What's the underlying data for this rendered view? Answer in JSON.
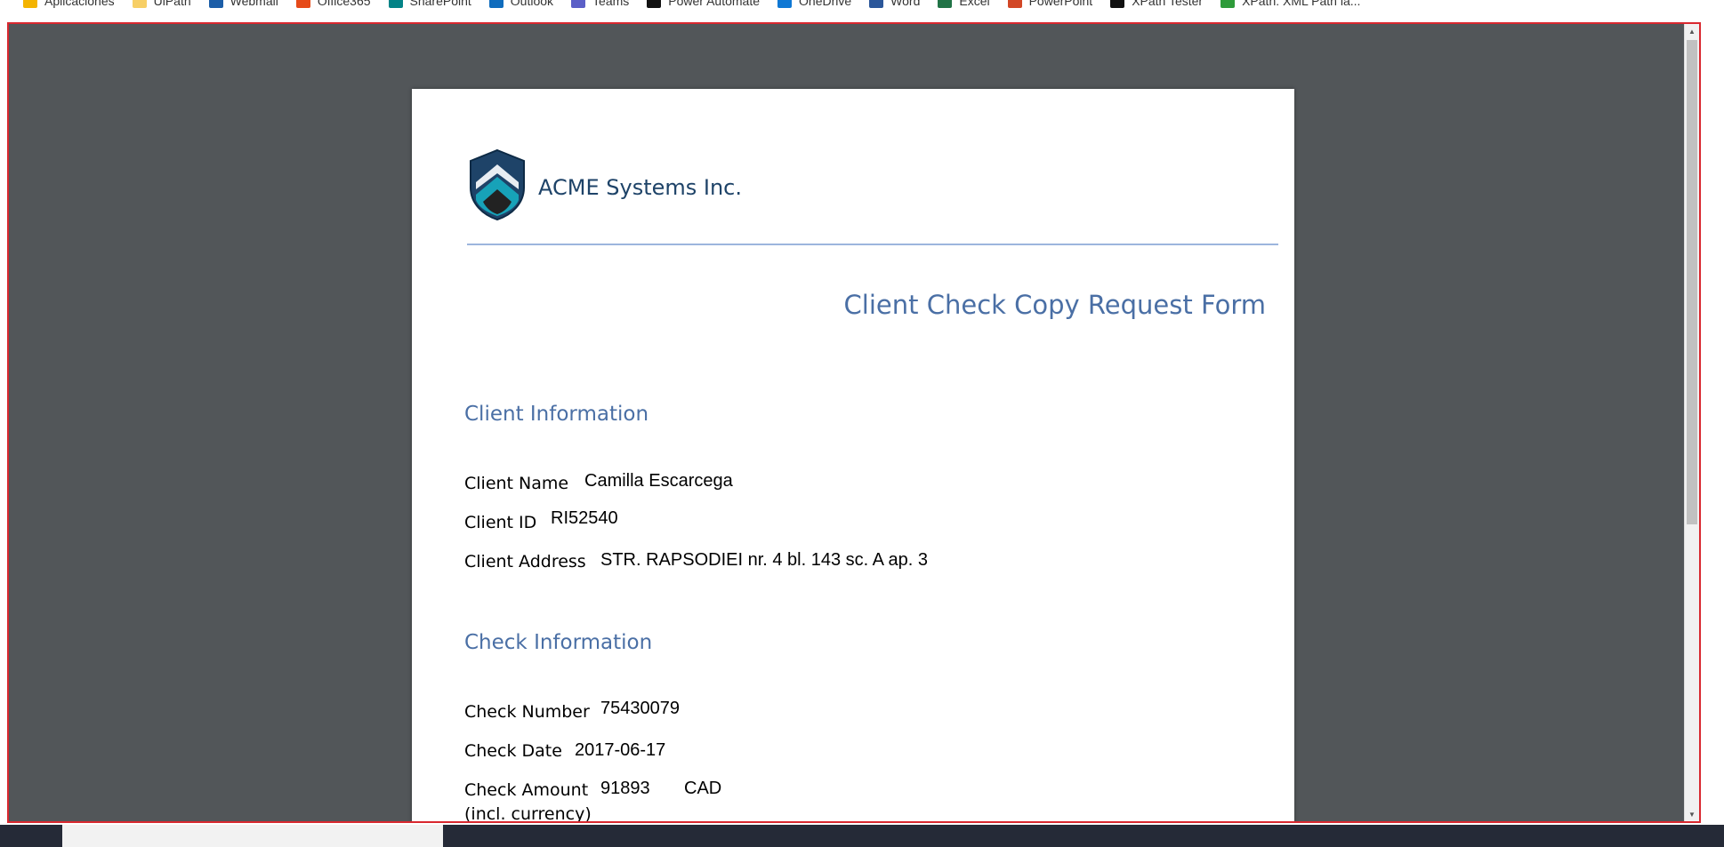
{
  "bookmarks": [
    {
      "label": "Aplicaciones",
      "icon": "apps-grid-icon",
      "color": "#f4b400"
    },
    {
      "label": "UiPath",
      "icon": "folder-icon",
      "color": "#f7cf66"
    },
    {
      "label": "Webmail",
      "icon": "mail-icon",
      "color": "#1c5ea8"
    },
    {
      "label": "Office365",
      "icon": "office-icon",
      "color": "#e64a19"
    },
    {
      "label": "SharePoint",
      "icon": "sharepoint-icon",
      "color": "#038387"
    },
    {
      "label": "Outlook",
      "icon": "outlook-icon",
      "color": "#0f6cbd"
    },
    {
      "label": "Teams",
      "icon": "teams-icon",
      "color": "#5b5fc7"
    },
    {
      "label": "Power Automate",
      "icon": "power-automate-icon",
      "color": "#111111"
    },
    {
      "label": "OneDrive",
      "icon": "onedrive-icon",
      "color": "#0f78d4"
    },
    {
      "label": "Word",
      "icon": "word-icon",
      "color": "#2b579a"
    },
    {
      "label": "Excel",
      "icon": "excel-icon",
      "color": "#217346"
    },
    {
      "label": "PowerPoint",
      "icon": "powerpoint-icon",
      "color": "#d24726"
    },
    {
      "label": "XPath Tester",
      "icon": "xpath-tester-icon",
      "color": "#111111"
    },
    {
      "label": "XPath: XML Path la...",
      "icon": "xpath-check-icon",
      "color": "#2e9b3a"
    }
  ],
  "document": {
    "company": "ACME Systems Inc.",
    "form_title": "Client Check Copy Request Form",
    "client_section": "Client Information",
    "client_name_label": "Client Name",
    "client_name": "Camilla Escarcega",
    "client_id_label": "Client ID",
    "client_id": "RI52540",
    "client_address_label": "Client Address",
    "client_address": "STR. RAPSODIEI nr. 4 bl. 143 sc. A ap. 3",
    "check_section": "Check Information",
    "check_number_label": "Check Number",
    "check_number": "75430079",
    "check_date_label": "Check Date",
    "check_date": "2017-06-17",
    "check_amount_label": "Check Amount",
    "check_amount_label_2": "(incl. currency)",
    "check_amount": "91893",
    "check_currency": "CAD"
  },
  "colors": {
    "viewer_background": "#525659",
    "highlight_border": "#d9282f",
    "heading_blue": "#4a6fa5",
    "company_blue": "#1e4368"
  }
}
